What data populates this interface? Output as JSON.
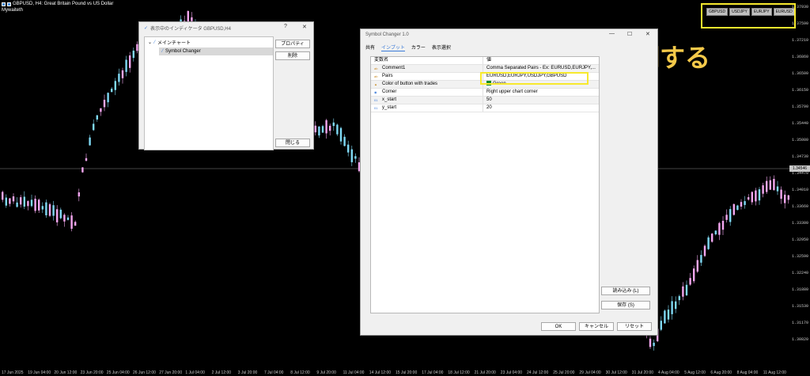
{
  "chart": {
    "title": "GBPUSD, H4:  Great Britain Pound vs US Dollar",
    "author": "Mywaiteth",
    "price_labels": [
      "1.37930",
      "1.37590",
      "1.37210",
      "1.36860",
      "1.36500",
      "1.36150",
      "1.35790",
      "1.35440",
      "1.35080",
      "1.34730",
      "1.34470",
      "1.34010",
      "1.33660",
      "1.33300",
      "1.32950",
      "1.32590",
      "1.32240",
      "1.31880",
      "1.31530",
      "1.31170",
      "1.30820"
    ],
    "current_price": "1.34546",
    "time_labels": [
      "17 Jun 2025",
      "19 Jun 04:00",
      "20 Jun 12:00",
      "23 Jun 20:00",
      "25 Jun 04:00",
      "26 Jun 12:00",
      "27 Jun 20:00",
      "1 Jul 04:00",
      "2 Jul 12:00",
      "3 Jul 20:00",
      "7 Jul 04:00",
      "8 Jul 12:00",
      "9 Jul 20:00",
      "11 Jul 04:00",
      "14 Jul 12:00",
      "15 Jul 20:00",
      "17 Jul 04:00",
      "18 Jul 12:00",
      "21 Jul 20:00",
      "23 Jul 04:00",
      "24 Jul 12:00",
      "25 Jul 20:00",
      "29 Jul 04:00",
      "30 Jul 12:00",
      "31 Jul 20:00",
      "4 Aug 04:00",
      "5 Aug 12:00",
      "6 Aug 20:00",
      "8 Aug 04:00",
      "11 Aug 12:00"
    ],
    "bull_color": "#f4a7f0",
    "bear_color": "#7fd9f4",
    "symbol_buttons": [
      "GBPUSD",
      "USDJPY",
      "EURJPY",
      "EURUSD"
    ],
    "annotation": "同期する",
    "annotation_color": "#f4c94a",
    "highlight_color": "#f7e92e"
  },
  "indicator_window": {
    "title": "表示中のインディケータ GBPUSD,H4",
    "help": "?",
    "close": "✕",
    "tree_root": "メインチャート",
    "tree_child": "Symbol Changer",
    "btn_properties": "プロパティ",
    "btn_delete": "削除",
    "btn_close": "閉じる"
  },
  "symbol_window": {
    "title": "Symbol Changer 1.0",
    "tabs": [
      "共有",
      "インプット",
      "カラー",
      "表示選択"
    ],
    "col_name": "変数名",
    "col_value": "値",
    "params": [
      {
        "type": "ab",
        "name": "Comment1",
        "value": "Comma Separated Pairs - Ex: EURUSD,EURJPY,..."
      },
      {
        "type": "ab",
        "name": "Pairs",
        "value": "EURUSD,EURJPY,USDJPY,GBPUSD"
      },
      {
        "type": "clr",
        "name": "Color of button with trades",
        "value": "Green"
      },
      {
        "type": "enum",
        "name": "Corner",
        "value": "Right upper chart corner"
      },
      {
        "type": "01",
        "name": "x_start",
        "value": "50"
      },
      {
        "type": "01",
        "name": "y_start",
        "value": "20"
      }
    ],
    "btn_load": "読み込み (L)",
    "btn_save": "保存 (S)",
    "btn_ok": "OK",
    "btn_cancel": "キャンセル",
    "btn_reset": "リセット"
  }
}
